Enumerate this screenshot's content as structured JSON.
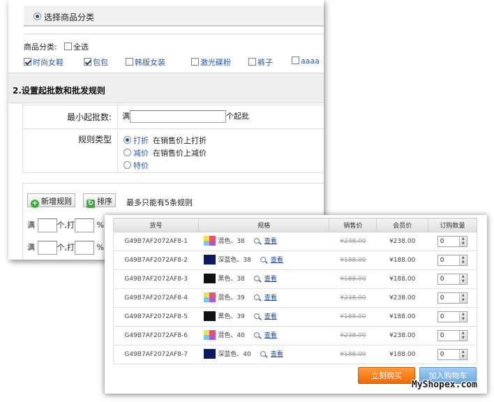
{
  "category_section": {
    "radio_label": "选择商品分类",
    "category_label": "商品分类:",
    "select_all_label": "全选",
    "items": [
      {
        "label": "时尚女鞋",
        "checked": true
      },
      {
        "label": "包包",
        "checked": true
      },
      {
        "label": "韩版女装",
        "checked": false
      },
      {
        "label": "激光碟粉",
        "checked": false
      },
      {
        "label": "裤子",
        "checked": false
      },
      {
        "label": "aaaa",
        "checked": false
      }
    ]
  },
  "wholesale_section": {
    "title": "2.设置起批数和批发规则",
    "min_qty_label": "最小起批数:",
    "min_qty_prefix": "满",
    "min_qty_value": "",
    "min_qty_suffix": "个起批",
    "rule_type_label": "规则类型",
    "rule_types": [
      {
        "name": "打折",
        "desc": "在销售价上打折",
        "selected": true
      },
      {
        "name": "减价",
        "desc": "在销售价上减价",
        "selected": false
      },
      {
        "name": "特价",
        "desc": "",
        "selected": false
      }
    ]
  },
  "rules": {
    "add_button_label": "新增规则",
    "sort_button_label": "排序",
    "note": "最多只能有5条规则",
    "rows": [
      {
        "prefix": "满",
        "mid": "个,打",
        "suffix": "%",
        "qty": "",
        "discount": ""
      },
      {
        "prefix": "满",
        "mid": "个,打",
        "suffix": "%",
        "qty": "",
        "discount": ""
      }
    ]
  },
  "product_table": {
    "headers": [
      "货号",
      "规格",
      "销售价",
      "会员价",
      "订购数量"
    ],
    "view_label": "查看",
    "rows": [
      {
        "sku": "G49B7AF2072AF8-1",
        "swatch": "multi",
        "spec": "混色、38",
        "price": "¥238.00",
        "member_price": "¥238.00",
        "qty": "0"
      },
      {
        "sku": "G49B7AF2072AF8-2",
        "swatch": "#0b1a5e",
        "spec": "深蓝色、38",
        "price": "¥188.00",
        "member_price": "¥188.00",
        "qty": "0"
      },
      {
        "sku": "G49B7AF2072AF8-3",
        "swatch": "#111111",
        "spec": "黑色、38",
        "price": "¥188.00",
        "member_price": "¥188.00",
        "qty": "0"
      },
      {
        "sku": "G49B7AF2072AF8-4",
        "swatch": "multi",
        "spec": "混色、39",
        "price": "¥238.00",
        "member_price": "¥238.00",
        "qty": "0"
      },
      {
        "sku": "G49B7AF2072AF8-5",
        "swatch": "#111111",
        "spec": "黑色、39",
        "price": "¥188.00",
        "member_price": "¥188.00",
        "qty": "0"
      },
      {
        "sku": "G49B7AF2072AF8-6",
        "swatch": "multi",
        "spec": "混色、40",
        "price": "¥238.00",
        "member_price": "¥238.00",
        "qty": "0"
      },
      {
        "sku": "G49B7AF2072AF8-7",
        "swatch": "#0b1a5e",
        "spec": "深蓝色、40",
        "price": "¥188.00",
        "member_price": "¥188.00",
        "qty": "0"
      }
    ],
    "buy_now_label": "立刻购买",
    "add_to_cart_label": "加入购物车"
  },
  "watermark": "MyShopex.com"
}
